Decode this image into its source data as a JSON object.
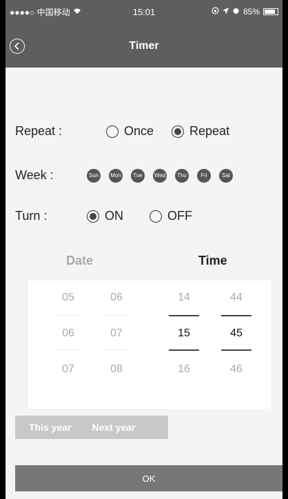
{
  "status": {
    "carrier": "●●●●○ 中国移动",
    "time": "15:01",
    "battery": "85%"
  },
  "nav": {
    "title": "Timer"
  },
  "repeat": {
    "label": "Repeat :",
    "once": "Once",
    "repeat": "Repeat",
    "selected": "repeat"
  },
  "week": {
    "label": "Week :",
    "days": [
      "Sun",
      "Mon",
      "Tue",
      "Wed",
      "Thu",
      "Fri",
      "Sat"
    ]
  },
  "turn": {
    "label": "Turn :",
    "on": "ON",
    "off": "OFF",
    "selected": "on"
  },
  "tabs": {
    "date": "Date",
    "time": "Time"
  },
  "picker": {
    "date_col1": [
      "05",
      "06",
      "07"
    ],
    "date_col2": [
      "06",
      "07",
      "08"
    ],
    "hours": [
      "14",
      "15",
      "16"
    ],
    "minutes": [
      "44",
      "45",
      "46"
    ]
  },
  "year_tabs": {
    "this_year": "This year",
    "next_year": "Next year"
  },
  "ok": "OK"
}
